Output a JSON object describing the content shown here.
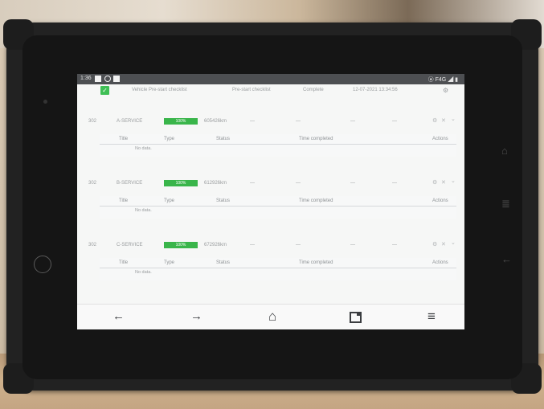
{
  "status_bar": {
    "time": "1:36",
    "signal_text": "⦿ F4G ◢ ▮"
  },
  "checklist_row": {
    "checkmark": "✓",
    "name": "Vehicle Pre-start checklist",
    "type": "Pre-start checklist",
    "status": "Complete",
    "timestamp": "12-07-2021 13:34:56",
    "action_icon": "⚙"
  },
  "services": [
    {
      "id": "302",
      "name": "A-SERVICE",
      "progress": "100%",
      "odometer": "605426km",
      "dashes": [
        "—",
        "—",
        "—",
        "—"
      ]
    },
    {
      "id": "302",
      "name": "B-SERVICE",
      "progress": "100%",
      "odometer": "612926km",
      "dashes": [
        "—",
        "—",
        "—",
        "—"
      ]
    },
    {
      "id": "302",
      "name": "C-SERVICE",
      "progress": "100%",
      "odometer": "672926km",
      "dashes": [
        "—",
        "—",
        "—",
        "—"
      ]
    }
  ],
  "subtable": {
    "headers": {
      "title": "Title",
      "type": "Type",
      "status": "Status",
      "time_completed": "Time completed",
      "actions": "Actions"
    },
    "empty_text": "No data."
  },
  "row_icons": {
    "settings": "⚙",
    "close": "✕",
    "expand": "⌄"
  },
  "nav": {
    "back": "←",
    "forward": "→",
    "home": "⌂",
    "menu": "≡"
  },
  "hardware": {
    "home": "⌂",
    "menu": "≣",
    "back": "←"
  },
  "colors": {
    "progress": "#39b54a",
    "checkbox": "#3fbf55",
    "status_bar": "#4d4f52"
  }
}
